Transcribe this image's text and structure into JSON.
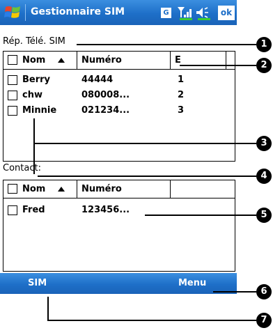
{
  "titlebar": {
    "app_title": "Gestionnaire SIM",
    "network_badge": "G",
    "ok_label": "ok"
  },
  "sim_list": {
    "label": "Rép. Télé. SIM",
    "headers": {
      "name": "Nom",
      "number": "Numéro",
      "entry": "E"
    },
    "rows": [
      {
        "name": "Berry",
        "number": "44444",
        "entry": "1"
      },
      {
        "name": "chw",
        "number": "080008...",
        "entry": "2"
      },
      {
        "name": "Minnie",
        "number": "021234...",
        "entry": "3"
      }
    ]
  },
  "contact_list": {
    "label": "Contact:",
    "headers": {
      "name": "Nom",
      "number": "Numéro"
    },
    "rows": [
      {
        "name": "Fred",
        "number": "123456..."
      }
    ]
  },
  "menubar": {
    "left_label": "SIM",
    "right_label": "Menu"
  },
  "callouts": [
    "1",
    "2",
    "3",
    "4",
    "5",
    "6",
    "7"
  ],
  "colors": {
    "titlebar": "#1e6fc8",
    "menubar": "#1e6fc8"
  },
  "icons": [
    "windows-start-icon",
    "signal-icon",
    "volume-icon",
    "sort-ascending-icon"
  ]
}
